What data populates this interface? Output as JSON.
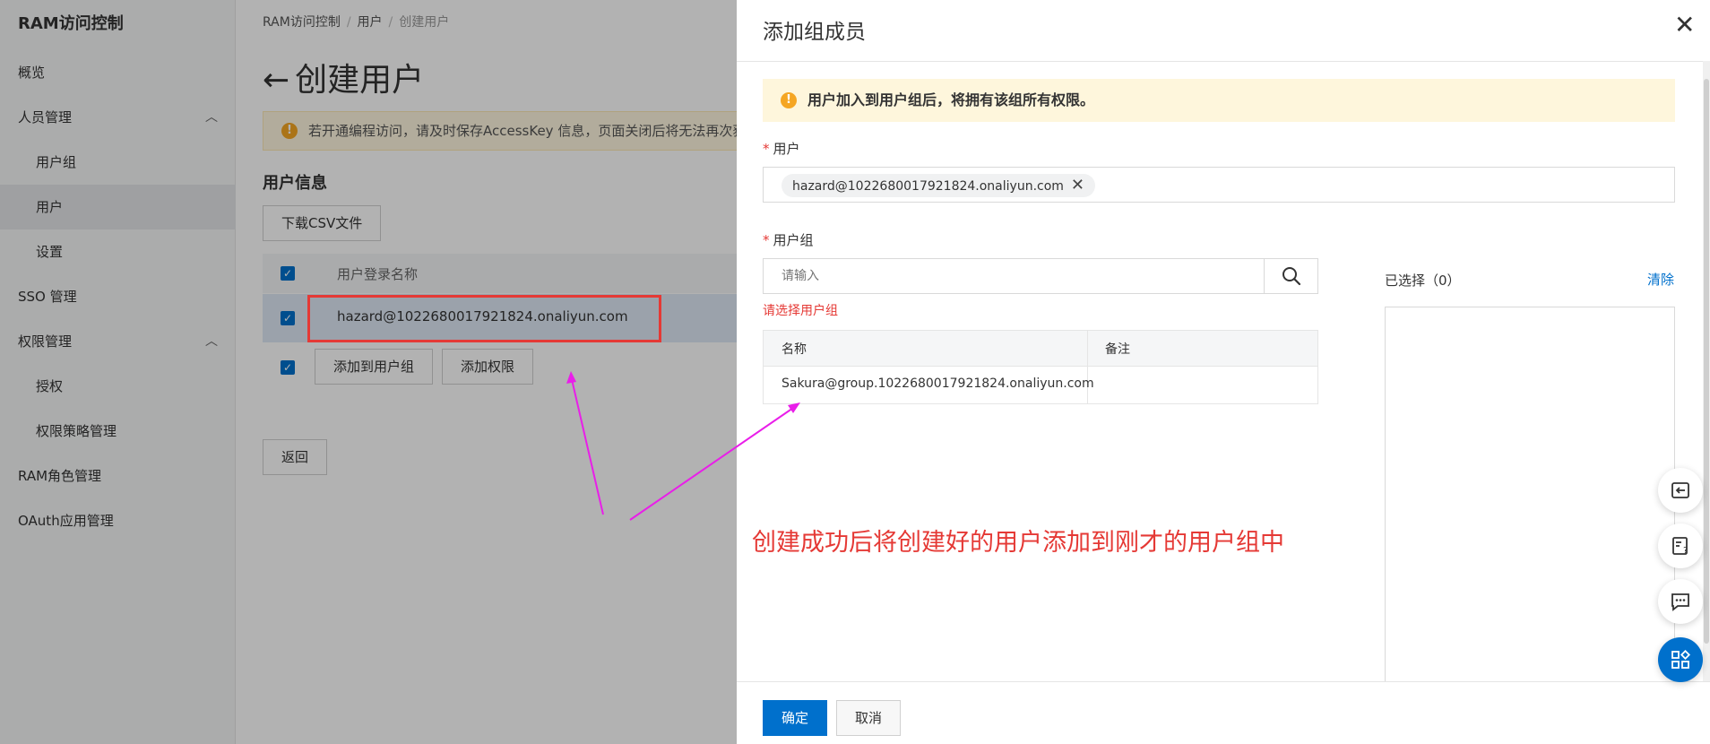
{
  "sidebar": {
    "title": "RAM访问控制",
    "items": [
      {
        "label": "概览"
      },
      {
        "label": "人员管理"
      },
      {
        "label": "用户组"
      },
      {
        "label": "用户"
      },
      {
        "label": "设置"
      },
      {
        "label": "SSO 管理"
      },
      {
        "label": "权限管理"
      },
      {
        "label": "授权"
      },
      {
        "label": "权限策略管理"
      },
      {
        "label": "RAM角色管理"
      },
      {
        "label": "OAuth应用管理"
      }
    ]
  },
  "breadcrumb": {
    "items": [
      "RAM访问控制",
      "用户",
      "创建用户"
    ]
  },
  "page": {
    "title": "创建用户",
    "warning": "若开通编程访问，请及时保存AccessKey 信息，页面关闭后将无法再次获",
    "section_title": "用户信息",
    "download_csv": "下载CSV文件",
    "table_header": "用户登录名称",
    "user_row": "hazard@1022680017921824.onaliyun.com",
    "add_to_group": "添加到用户组",
    "add_permission": "添加权限",
    "back": "返回"
  },
  "drawer": {
    "title": "添加组成员",
    "notice": "用户加入到用户组后，将拥有该组所有权限。",
    "user_label": "用户",
    "user_tag": "hazard@1022680017921824.onaliyun.com",
    "group_label": "用户组",
    "search_placeholder": "请输入",
    "error": "请选择用户组",
    "columns": [
      "名称",
      "备注"
    ],
    "groups": [
      {
        "name": "Sakura@group.1022680017921824.onaliyun.com",
        "note": ""
      }
    ],
    "selected_label": "已选择（0）",
    "clear": "清除",
    "confirm": "确定",
    "cancel": "取消"
  },
  "annotation": "创建成功后将创建好的用户添加到刚才的用户组中",
  "colors": {
    "accent": "#0070cc",
    "error": "#e53935",
    "annotation_arrow": "#e91ee9"
  }
}
